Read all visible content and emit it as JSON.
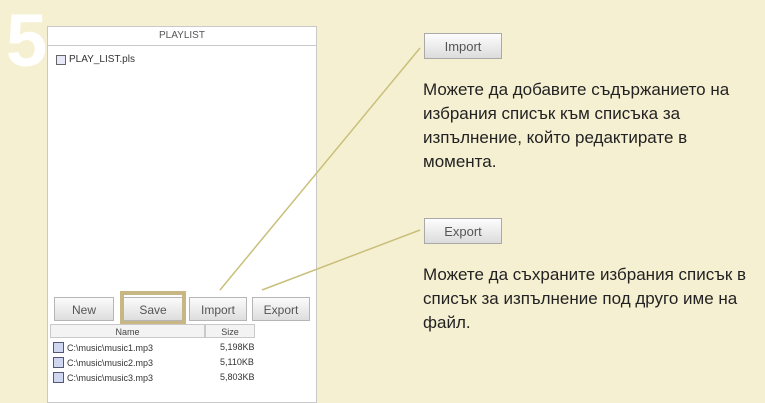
{
  "step_number": "5",
  "panel": {
    "title": "PLAYLIST",
    "playlist_file": "PLAY_LIST.pls",
    "buttons": {
      "new": "New",
      "save": "Save",
      "import": "Import",
      "export": "Export"
    },
    "table": {
      "headers": {
        "name": "Name",
        "size": "Size"
      },
      "rows": [
        {
          "name": "C:\\music\\music1.mp3",
          "size": "5,198KB"
        },
        {
          "name": "C:\\music\\music2.mp3",
          "size": "5,110KB"
        },
        {
          "name": "C:\\music\\music3.mp3",
          "size": "5,803KB"
        }
      ]
    }
  },
  "callouts": {
    "import": {
      "button_label": "Import",
      "description": "Можете да добавите съдържанието на избрания списък към списъка за изпълнение, който редактирате в момента."
    },
    "export": {
      "button_label": "Export",
      "description": "Можете да съхраните избрания списък в списък за изпълнение под друго име на файл."
    }
  },
  "colors": {
    "background": "#f6f0d2",
    "highlight_border": "#c8b783",
    "connector_line": "#c8c07a"
  }
}
